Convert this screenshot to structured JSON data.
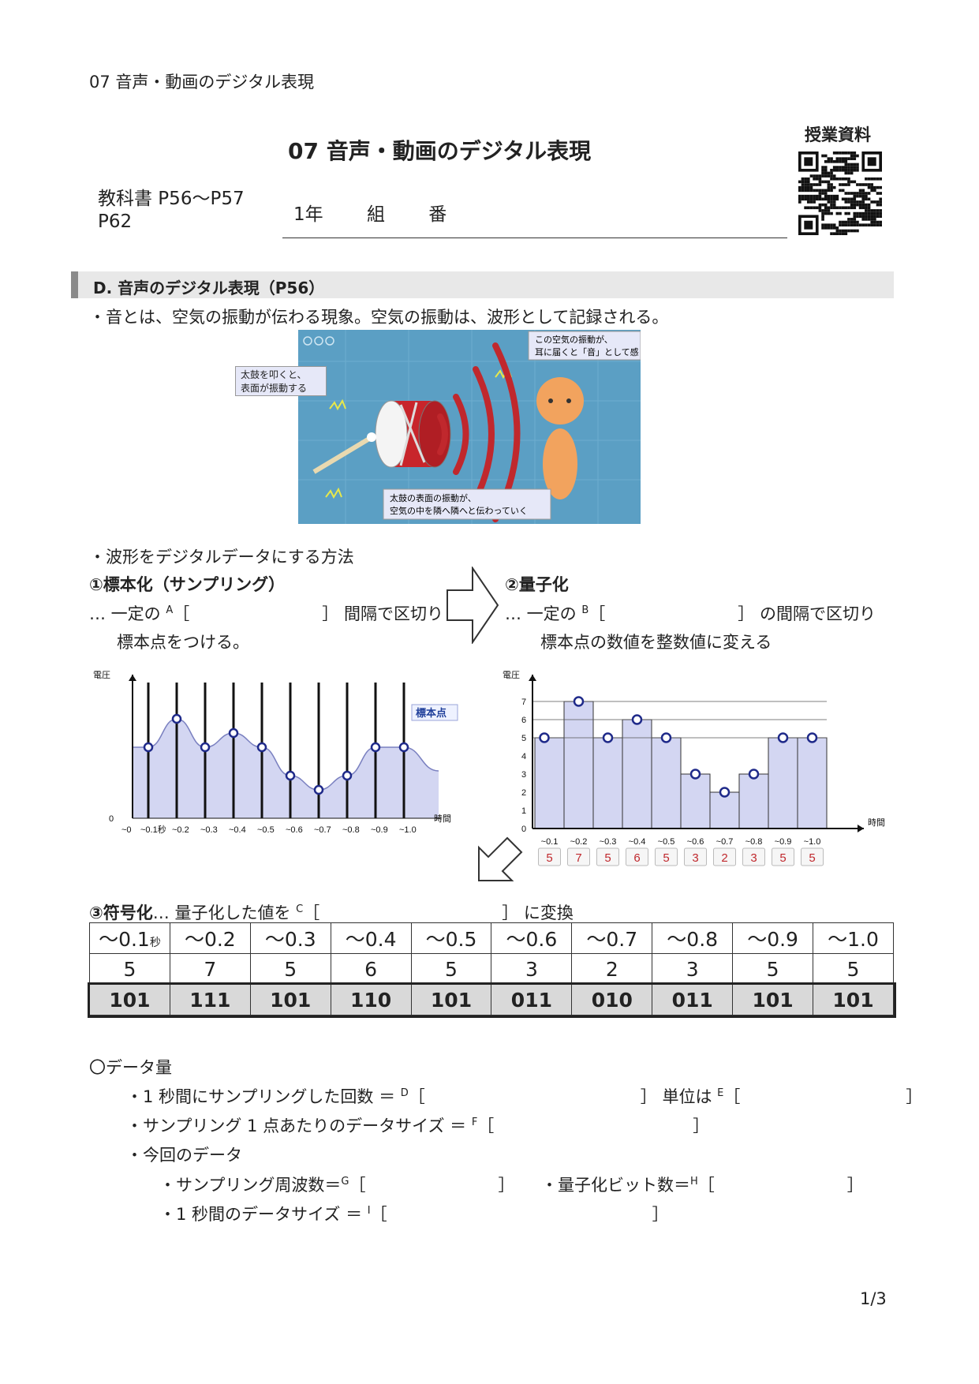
{
  "header": {
    "running_title": "07 音声・動画のデジタル表現"
  },
  "title": "07 音声・動画のデジタル表現",
  "qr": {
    "label": "授業資料",
    "icon": "qr-code-icon"
  },
  "textbook": {
    "line1": "教科書 P56～P57",
    "line2": "P62"
  },
  "class_line": {
    "year": "1年",
    "kumi": "組",
    "ban": "番"
  },
  "section": {
    "title": "D.  音声のデジタル表現（P56）"
  },
  "intro": "・音とは、空気の振動が伝わる現象。空気の振動は、波形として記録される。",
  "illustration": {
    "bubble_drum": [
      "太鼓を叩くと、",
      "表面が振動する"
    ],
    "bubble_ear": [
      "この空気の振動が、",
      "耳に届くと「音」として感じる"
    ],
    "bubble_air": [
      "太鼓の表面の振動が、",
      "空気の中を隣へ隣へと伝わっていく"
    ],
    "colors": {
      "bg": "#5b9fc4",
      "drum": "#c8252b",
      "wave": "#c0282d",
      "figure": "#f2a35e"
    }
  },
  "method_heading": "・波形をデジタルデータにする方法",
  "step1": {
    "title": "①標本化（サンプリング）",
    "line1_pre": "…  一定の",
    "mark": "A",
    "line1_post": "［　　　　　　　　］ 間隔で区切り",
    "line2": "標本点をつける。"
  },
  "step2": {
    "title": "②量子化",
    "line1_pre": "…  一定の",
    "mark": "B",
    "line1_post": "［　　　　　　　　］ の間隔で区切り",
    "line2": "標本点の数値を整数値に変える"
  },
  "chart_data": [
    {
      "type": "area",
      "ylabel": "電圧",
      "xlabel": "時間",
      "y_tick": "0",
      "annotation": "標本点",
      "x_labels": [
        "~0.1秒",
        "~0.2",
        "~0.3",
        "~0.4",
        "~0.5",
        "~0.6",
        "~0.7",
        "~0.8",
        "~0.9",
        "~1.0"
      ],
      "x_origin_label": "~0",
      "values": [
        5,
        7,
        5,
        6,
        5,
        3,
        2,
        3,
        5,
        5
      ],
      "ylim": [
        0,
        9
      ]
    },
    {
      "type": "bar",
      "ylabel": "電圧",
      "xlabel": "時間",
      "categories": [
        "~0.1",
        "~0.2",
        "~0.3",
        "~0.4",
        "~0.5",
        "~0.6",
        "~0.7",
        "~0.8",
        "~0.9",
        "~1.0"
      ],
      "values": [
        5,
        7,
        5,
        6,
        5,
        3,
        2,
        3,
        5,
        5
      ],
      "yticks": [
        0,
        1,
        2,
        3,
        4,
        5,
        6,
        7
      ],
      "ylim": [
        0,
        8
      ]
    }
  ],
  "step3": {
    "title": "③符号化",
    "pre": "…  量子化した値を",
    "mark": "C",
    "post": "［　　　　　　　　　　　］ に変換"
  },
  "code_table": {
    "times": [
      "～0.1秒",
      "～0.2",
      "～0.3",
      "～0.4",
      "～0.5",
      "～0.6",
      "～0.7",
      "～0.8",
      "～0.9",
      "～1.0"
    ],
    "values": [
      "5",
      "7",
      "5",
      "6",
      "5",
      "3",
      "2",
      "3",
      "5",
      "5"
    ],
    "binary": [
      "101",
      "111",
      "101",
      "110",
      "101",
      "011",
      "010",
      "011",
      "101",
      "101"
    ]
  },
  "data_amount": {
    "heading": "〇データ量",
    "l1_pre": "・1 秒間にサンプリングした回数 ＝",
    "l1_mark": "D",
    "l1_post": "［　　　　　　　　　　　　　］ 単位は",
    "l1_mark2": "E",
    "l1_post2": "［　　　　　　　　　　］",
    "l2_pre": "・サンプリング 1 点あたりのデータサイズ ＝",
    "l2_mark": "F",
    "l2_post": "［　　　　　　　　　　　　］",
    "l3": "・今回のデータ",
    "l4_pre": "・サンプリング周波数＝",
    "l4_mark": "G",
    "l4_post": "［　　　　　　　　］",
    "l4b_pre": "・量子化ビット数＝",
    "l4b_mark": "H",
    "l4b_post": "［　　　　　　　　］",
    "l5_pre": "・1 秒間のデータサイズ ＝",
    "l5_mark": "I",
    "l5_post": "［　　　　　　　　　　　　　　　　］"
  },
  "page_number": "1/3"
}
